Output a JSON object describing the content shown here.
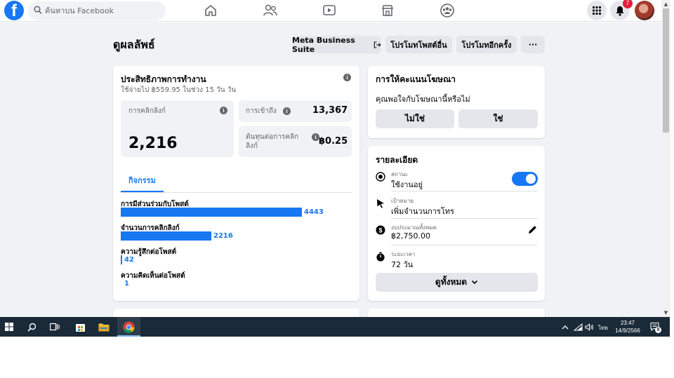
{
  "nav": {
    "search_placeholder": "ค้นหาบน Facebook",
    "notification_count": "7",
    "logo_letter": "f"
  },
  "page": {
    "title": "ดูผลลัพธ์",
    "buttons": {
      "business_suite": "Meta Business Suite",
      "promote_other": "โปรโมทโพสต์อื่น",
      "promote_again": "โปรโมทอีกครั้ง",
      "more": "···"
    }
  },
  "performance": {
    "title": "ประสิทธิภาพการทำงาน",
    "subtitle": "ใช้จ่ายไป ฿559.95 ในช่วง 15 วัน วัน",
    "metrics": {
      "link_clicks_label": "การคลิกลิงก์",
      "link_clicks_value": "2,216",
      "reach_label": "การเข้าถึง",
      "reach_value": "13,367",
      "cost_label": "ต้นทุนต่อการคลิกลิงก์",
      "cost_value": "฿0.25"
    },
    "tab_activity": "กิจกรรม",
    "activity": [
      {
        "label": "การมีส่วนร่วมกับโพสต์",
        "value": 4443
      },
      {
        "label": "จำนวนการคลิกลิงก์",
        "value": 2216
      },
      {
        "label": "ความรู้สึกต่อโพสต์",
        "value": 42
      },
      {
        "label": "ความคิดเห็นต่อโพสต์",
        "value": 1
      }
    ]
  },
  "rating": {
    "title": "การให้คะแนนโฆษณา",
    "question": "คุณพอใจกับโฆษณานี้หรือไม่",
    "no_label": "ไม่ใช่",
    "yes_label": "ใช่"
  },
  "details": {
    "title": "รายละเอียด",
    "status_label": "สถานะ",
    "status_value": "ใช้งานอยู่",
    "status_active": true,
    "goal_label": "เป้าหมาย",
    "goal_value": "เพิ่มจำนวนการโทร",
    "budget_label": "งบประมาณทั้งหมด",
    "budget_value": "฿2,750.00",
    "duration_label": "ระยะเวลา",
    "duration_value": "72 วัน",
    "see_all": "ดูทั้งหมด"
  },
  "taskbar": {
    "language": "ไทย",
    "time": "23:47",
    "date": "14/9/2566",
    "notif_count": "9"
  },
  "colors": {
    "accent": "#1877f2",
    "page_bg": "#f0f2f5",
    "button_bg": "#e4e6eb",
    "taskbar": "#1b2a38",
    "badge": "#e41e3f"
  }
}
